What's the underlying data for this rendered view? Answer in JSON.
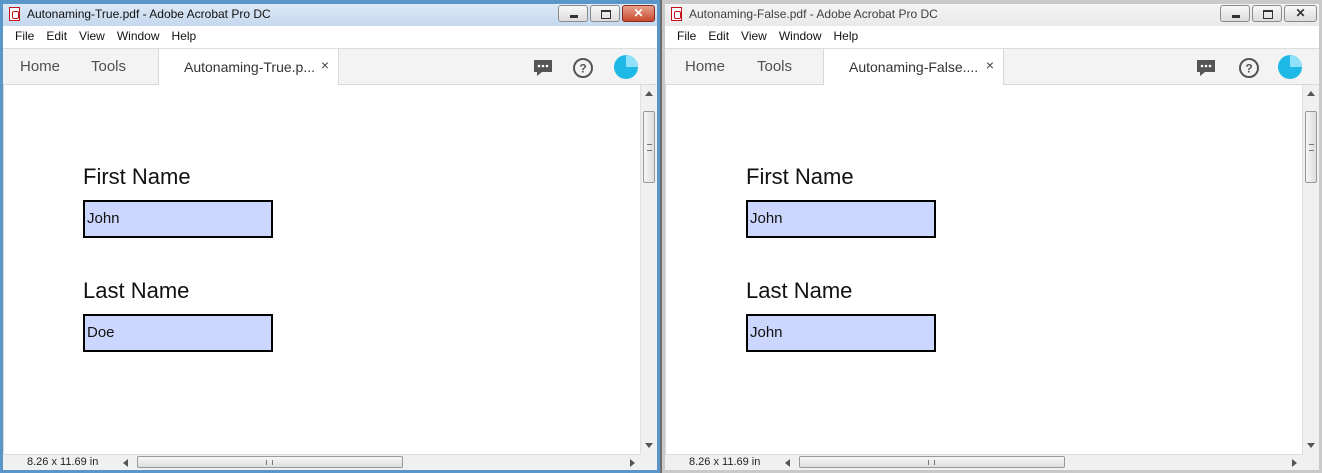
{
  "windows": [
    {
      "title": "Autonaming-True.pdf - Adobe Acrobat Pro DC",
      "menu": [
        "File",
        "Edit",
        "View",
        "Window",
        "Help"
      ],
      "nav": {
        "home": "Home",
        "tools": "Tools"
      },
      "tab": {
        "label": "Autonaming-True.p...",
        "close": "×"
      },
      "fields": [
        {
          "label": "First Name",
          "value": "John"
        },
        {
          "label": "Last Name",
          "value": "Doe"
        }
      ],
      "status": {
        "page_size": "8.26 x 11.69 in"
      }
    },
    {
      "title": "Autonaming-False.pdf - Adobe Acrobat Pro DC",
      "menu": [
        "File",
        "Edit",
        "View",
        "Window",
        "Help"
      ],
      "nav": {
        "home": "Home",
        "tools": "Tools"
      },
      "tab": {
        "label": "Autonaming-False....",
        "close": "×"
      },
      "fields": [
        {
          "label": "First Name",
          "value": "John"
        },
        {
          "label": "Last Name",
          "value": "John"
        }
      ],
      "status": {
        "page_size": "8.26 x 11.69 in"
      }
    }
  ],
  "icons": {
    "comment": "comment-icon",
    "help": "help-icon",
    "account": "account-icon",
    "pdf": "pdf-icon"
  },
  "colors": {
    "field_fill": "#ccd7ff",
    "active_frame": "#5b96c9",
    "avatar": "#1fb9e8"
  }
}
